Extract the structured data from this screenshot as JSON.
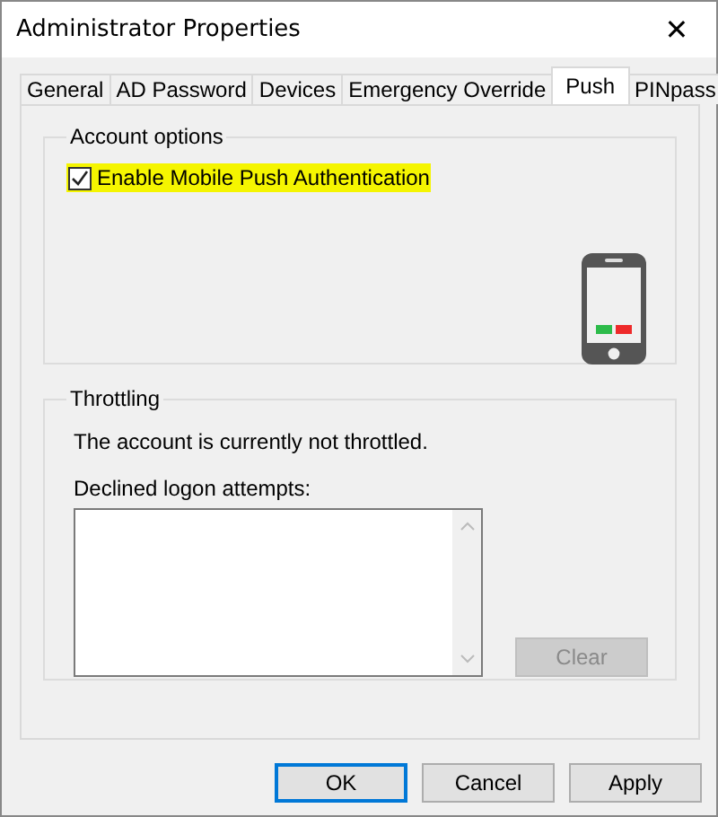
{
  "window": {
    "title": "Administrator Properties",
    "close": "✕"
  },
  "tabs": [
    {
      "label": "General",
      "selected": false
    },
    {
      "label": "AD Password",
      "selected": false
    },
    {
      "label": "Devices",
      "selected": false
    },
    {
      "label": "Emergency Override",
      "selected": false
    },
    {
      "label": "Push",
      "selected": true
    },
    {
      "label": "PINpass",
      "selected": false
    }
  ],
  "account_options": {
    "title": "Account options",
    "checkbox": {
      "label": "Enable Mobile Push Authentication",
      "checked": true,
      "highlighted": true
    }
  },
  "throttling": {
    "title": "Throttling",
    "status": "The account is currently not throttled.",
    "list_label": "Declined logon attempts:",
    "clear_button": {
      "label": "Clear",
      "disabled": true
    }
  },
  "buttons": [
    {
      "label": "OK",
      "default": true
    },
    {
      "label": "Cancel",
      "default": false
    },
    {
      "label": "Apply",
      "default": false
    }
  ]
}
